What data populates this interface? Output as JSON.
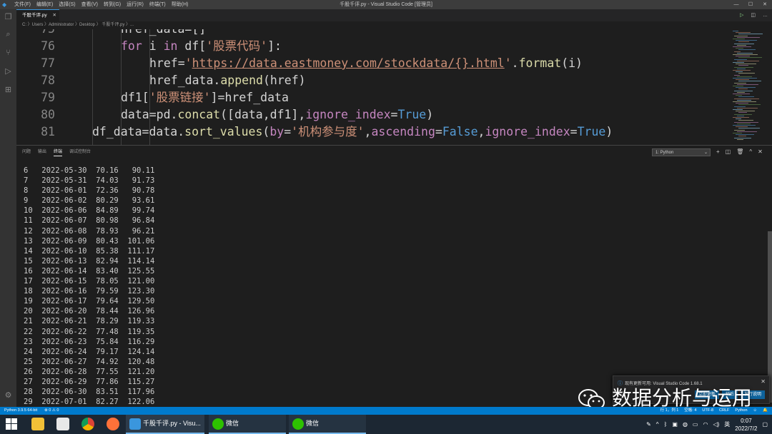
{
  "window": {
    "title": "千股千评.py - Visual Studio Code [管理员]",
    "menus": [
      "文件(F)",
      "编辑(E)",
      "选择(S)",
      "查看(V)",
      "转到(G)",
      "运行(R)",
      "终端(T)",
      "帮助(H)"
    ],
    "controls": [
      "—",
      "☐",
      "✕"
    ]
  },
  "tab": {
    "label": "千股千评.py",
    "close": "✕"
  },
  "breadcrumb": "C: 〉Users 〉Administrator 〉Desktop 〉 千股千评.py 〉...",
  "editor": {
    "lines": [
      {
        "n": "75",
        "text": "href_data=[]"
      },
      {
        "n": "76",
        "text": "for i in df['股票代码']:"
      },
      {
        "n": "77",
        "text": "href='https://data.eastmoney.com/stockdata/{}.html'.format(i)"
      },
      {
        "n": "78",
        "text": "href_data.append(href)"
      },
      {
        "n": "79",
        "text": "df1['股票链接']=href_data"
      },
      {
        "n": "80",
        "text": "data=pd.concat([data,df1],ignore_index=True)"
      },
      {
        "n": "81",
        "text": "df_data=data.sort_values(by='机构参与度',ascending=False,ignore_index=True)"
      }
    ]
  },
  "panel": {
    "tabs": [
      "问题",
      "输出",
      "终端",
      "调试控制台"
    ],
    "active_tab": "终端",
    "terminal_select": "1: Python",
    "actions": [
      "+",
      "◫",
      "🗑",
      "^",
      "✕"
    ]
  },
  "terminal_rows": [
    [
      "6",
      "2022-05-30",
      "70.16",
      "90.11"
    ],
    [
      "7",
      "2022-05-31",
      "74.03",
      "91.73"
    ],
    [
      "8",
      "2022-06-01",
      "72.36",
      "90.78"
    ],
    [
      "9",
      "2022-06-02",
      "80.29",
      "93.61"
    ],
    [
      "10",
      "2022-06-06",
      "84.89",
      "99.74"
    ],
    [
      "11",
      "2022-06-07",
      "80.98",
      "96.84"
    ],
    [
      "12",
      "2022-06-08",
      "78.93",
      "96.21"
    ],
    [
      "13",
      "2022-06-09",
      "80.43",
      "101.06"
    ],
    [
      "14",
      "2022-06-10",
      "85.38",
      "111.17"
    ],
    [
      "15",
      "2022-06-13",
      "82.94",
      "114.14"
    ],
    [
      "16",
      "2022-06-14",
      "83.40",
      "125.55"
    ],
    [
      "17",
      "2022-06-15",
      "78.05",
      "121.00"
    ],
    [
      "18",
      "2022-06-16",
      "79.59",
      "123.30"
    ],
    [
      "19",
      "2022-06-17",
      "79.64",
      "129.50"
    ],
    [
      "20",
      "2022-06-20",
      "78.44",
      "126.96"
    ],
    [
      "21",
      "2022-06-21",
      "78.29",
      "119.33"
    ],
    [
      "22",
      "2022-06-22",
      "77.48",
      "119.35"
    ],
    [
      "23",
      "2022-06-23",
      "75.84",
      "116.29"
    ],
    [
      "24",
      "2022-06-24",
      "79.17",
      "124.14"
    ],
    [
      "25",
      "2022-06-27",
      "74.92",
      "120.48"
    ],
    [
      "26",
      "2022-06-28",
      "77.55",
      "121.20"
    ],
    [
      "27",
      "2022-06-29",
      "77.86",
      "115.27"
    ],
    [
      "28",
      "2022-06-30",
      "83.51",
      "117.96"
    ],
    [
      "29",
      "2022-07-01",
      "82.27",
      "122.06"
    ]
  ],
  "notification": {
    "message": "现有更新可用: Visual Studio Code 1.68.1",
    "buttons": [
      "立即更新",
      "稍后",
      "发行说明"
    ]
  },
  "watermark": "数据分析与运用",
  "statusbar": {
    "python": "Python 3.9.5 64-bit",
    "problems": "⊗ 0 ⚠ 0",
    "position": "行 1，列 1",
    "spaces": "空格: 4",
    "encoding": "UTF-8",
    "eol": "CRLF",
    "language": "Python"
  },
  "taskbar": {
    "task_vscode": "千股千评.py - Visu...",
    "task_wechat1": "微信",
    "task_wechat2": "微信",
    "ime": "英",
    "time": "0:07",
    "date": "2022/7/2"
  },
  "colors": {
    "accent": "#007acc",
    "keyword": "#c586c0",
    "string": "#ce9178",
    "constant": "#569cd6"
  }
}
